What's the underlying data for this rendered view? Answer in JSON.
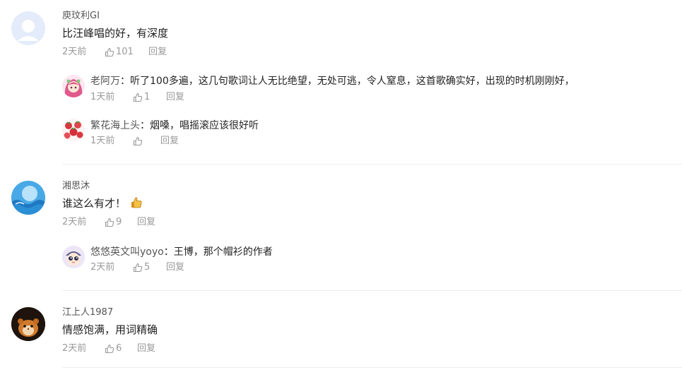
{
  "comments": [
    {
      "user": "庾玟利GI",
      "text": "比汪峰唱的好，有深度",
      "time": "2天前",
      "likes": "101",
      "reply_label": "回复",
      "replies": [
        {
          "user": "老阿万",
          "text": "：听了100多遍，这几句歌词让人无比绝望，无处可逃，令人窒息，这首歌确实好，出现的时机刚刚好，",
          "time": "1天前",
          "likes": "1",
          "reply_label": "回复"
        },
        {
          "user": "繁花海上头",
          "text": "：烟嗓，唱摇滚应该很好听",
          "time": "1天前",
          "likes": "",
          "reply_label": "回复"
        }
      ]
    },
    {
      "user": "湘思沐",
      "text": "谁这么有才！",
      "emoji": "thumbs-up-emoji",
      "time": "2天前",
      "likes": "9",
      "reply_label": "回复",
      "replies": [
        {
          "user": "悠悠英文叫yoyo",
          "text": "：王博，那个帽衫的作者",
          "time": "2天前",
          "likes": "5",
          "reply_label": "回复"
        }
      ]
    },
    {
      "user": "江上人1987",
      "text": "情感饱满，用词精确",
      "time": "2天前",
      "likes": "6",
      "reply_label": "回复",
      "replies": []
    }
  ]
}
